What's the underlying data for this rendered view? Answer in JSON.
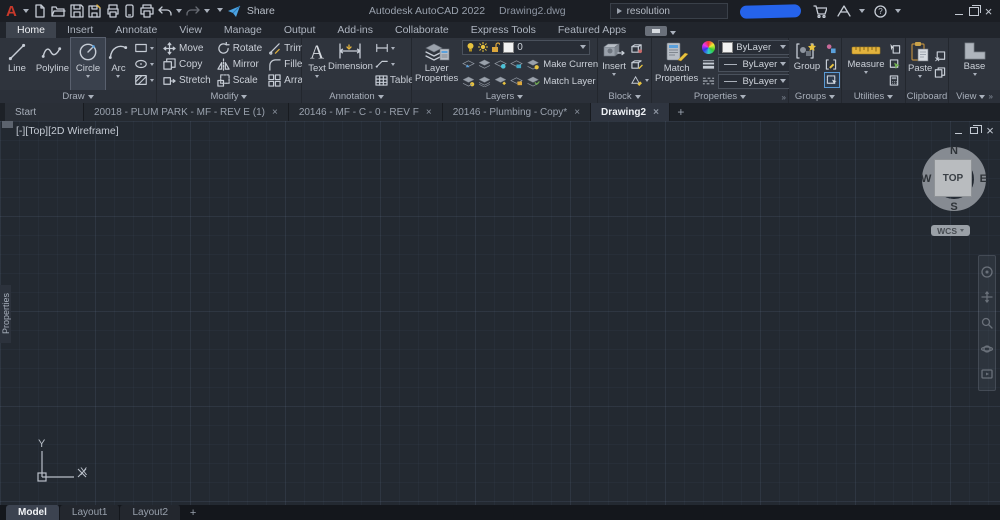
{
  "titlebar": {
    "app_title": "Autodesk AutoCAD 2022",
    "doc_title": "Drawing2.dwg",
    "share_label": "Share",
    "search_text": "resolution",
    "redaction_color": "#2563eb"
  },
  "ribbon_tabs": [
    {
      "label": "Home",
      "active": true
    },
    {
      "label": "Insert",
      "active": false
    },
    {
      "label": "Annotate",
      "active": false
    },
    {
      "label": "View",
      "active": false
    },
    {
      "label": "Manage",
      "active": false
    },
    {
      "label": "Output",
      "active": false
    },
    {
      "label": "Add-ins",
      "active": false
    },
    {
      "label": "Collaborate",
      "active": false
    },
    {
      "label": "Express Tools",
      "active": false
    },
    {
      "label": "Featured Apps",
      "active": false
    }
  ],
  "ribbon": {
    "draw": {
      "label": "Draw",
      "buttons": [
        "Line",
        "Polyline",
        "Circle",
        "Arc"
      ]
    },
    "modify": {
      "label": "Modify",
      "rows": [
        [
          "Move",
          "Rotate",
          "Trim"
        ],
        [
          "Copy",
          "Mirror",
          "Fillet"
        ],
        [
          "Stretch",
          "Scale",
          "Array"
        ]
      ]
    },
    "annotation": {
      "label": "Annotation",
      "text_btn": "Text",
      "dimension_btn": "Dimension",
      "table_btn": "Table"
    },
    "layers": {
      "label": "Layers",
      "big_btn": "Layer Properties",
      "current_layer": "0",
      "make_current": "Make Current",
      "match_layer": "Match Layer"
    },
    "block": {
      "label": "Block",
      "big_btn": "Insert"
    },
    "properties_panel": {
      "label": "Properties",
      "big_btn": "Match Properties",
      "color_value": "ByLayer",
      "lineweight_value": "ByLayer",
      "linetype_value": "ByLayer"
    },
    "groups": {
      "label": "Groups",
      "big_btn": "Group"
    },
    "utilities": {
      "label": "Utilities",
      "big_btn": "Measure"
    },
    "clipboard": {
      "label": "Clipboard",
      "big_btn": "Paste"
    },
    "view": {
      "label": "View",
      "big_btn": "Base"
    }
  },
  "file_tabs": [
    {
      "label": "Start",
      "closable": false,
      "active": false
    },
    {
      "label": "20018 - PLUM PARK - MF - REV E (1)",
      "closable": true,
      "active": false
    },
    {
      "label": "20146 - MF - C - 0 - REV F",
      "closable": true,
      "active": false
    },
    {
      "label": "20146 - Plumbing - Copy*",
      "closable": true,
      "active": false
    },
    {
      "label": "Drawing2",
      "closable": true,
      "active": true
    }
  ],
  "viewport": {
    "controls_label": "[-][Top][2D Wireframe]",
    "palette_tab": "Properties",
    "viewcube": {
      "north": "N",
      "south": "S",
      "east": "E",
      "west": "W",
      "face": "TOP",
      "coord_system": "WCS"
    },
    "ucs": {
      "x_label": "X",
      "y_label": "Y"
    }
  },
  "layout_tabs": [
    {
      "label": "Model",
      "active": true
    },
    {
      "label": "Layout1",
      "active": false
    },
    {
      "label": "Layout2",
      "active": false
    }
  ],
  "colors": {
    "canvas": "#232931",
    "accent_yellow": "#e3b33d",
    "redaction_blue": "#2563eb"
  }
}
